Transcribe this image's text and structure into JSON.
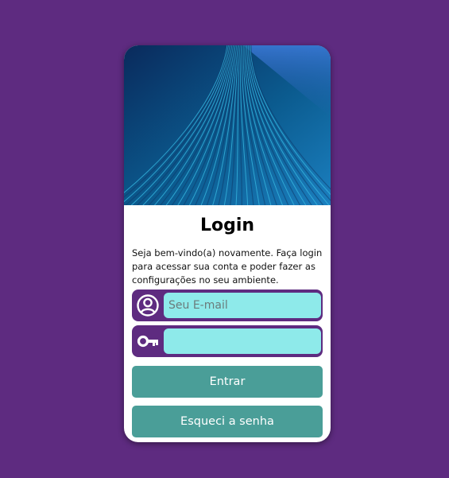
{
  "colors": {
    "background": "#5e2b80",
    "card": "#ffffff",
    "field_frame": "#5e2b80",
    "input_fill": "#8eeaea",
    "button": "#4a9e98",
    "button_text": "#ffffff"
  },
  "login": {
    "title": "Login",
    "intro": "Seja bem-vindo(a) novamente. Faça login para acessar sua conta e poder fazer as configurações no seu ambiente.",
    "email": {
      "icon": "user-circle-icon",
      "placeholder": "Seu E-mail",
      "value": ""
    },
    "password": {
      "icon": "key-icon",
      "placeholder": "",
      "value": ""
    },
    "submit_label": "Entrar",
    "forgot_label": "Esqueci a senha"
  }
}
